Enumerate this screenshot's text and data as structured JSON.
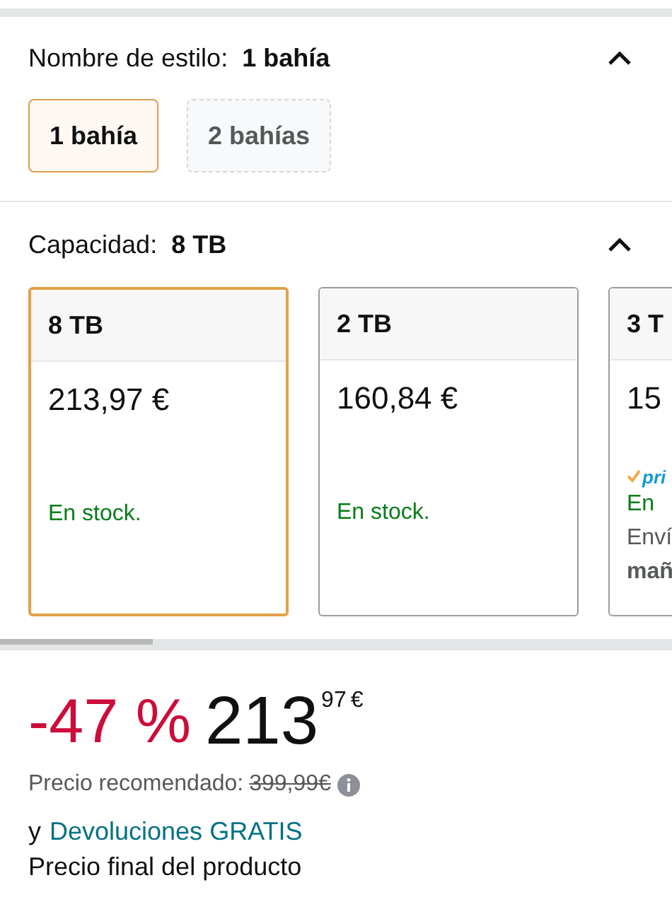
{
  "style_section": {
    "label": "Nombre de estilo:",
    "value": "1 bahía",
    "expanded": true,
    "options": [
      {
        "label": "1 bahía",
        "selected": true,
        "available": true
      },
      {
        "label": "2 bahías",
        "selected": false,
        "available": false
      }
    ]
  },
  "capacity_section": {
    "label": "Capacidad:",
    "value": "8 TB",
    "expanded": true,
    "cards": [
      {
        "title": "8 TB",
        "price": "213,97 €",
        "stock": "En stock.",
        "selected": true
      },
      {
        "title": "2 TB",
        "price": "160,84 €",
        "stock": "En stock.",
        "selected": false
      },
      {
        "title": "3 T",
        "price": "15",
        "prime": "pri",
        "stock": "En",
        "delivery": "Enví",
        "delivery_bold": "mañ",
        "selected": false
      }
    ]
  },
  "price": {
    "discount": "-47 %",
    "whole": "213",
    "fraction": "97",
    "currency": "€",
    "recommended_label": "Precio recomendado:",
    "recommended_price": "399,99€",
    "returns_prefix": "y",
    "returns_link": "Devoluciones GRATIS",
    "final_note": "Precio final del producto"
  }
}
